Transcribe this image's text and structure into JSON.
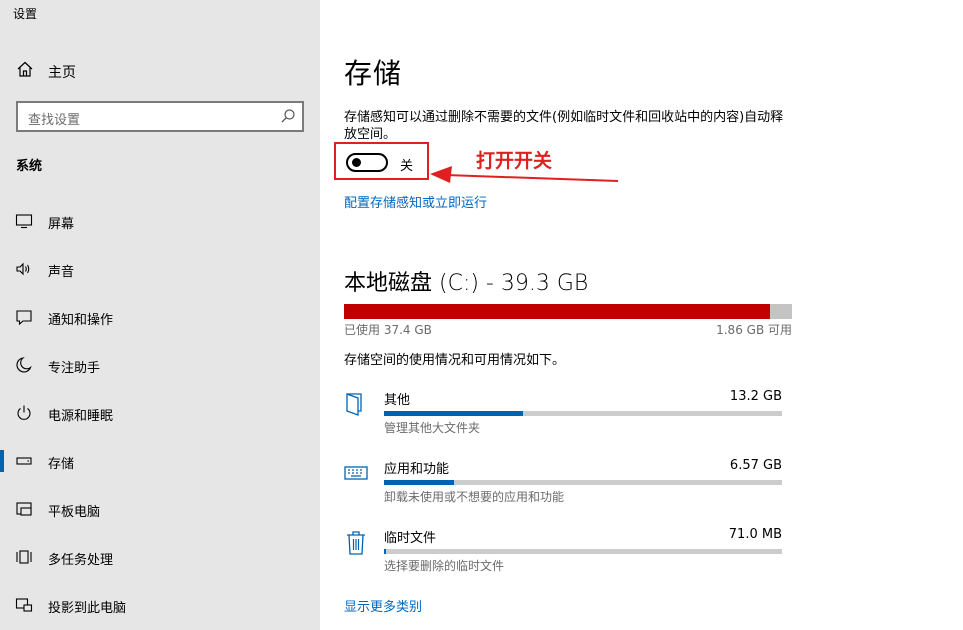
{
  "window": {
    "title": "设置"
  },
  "sidebar": {
    "home_label": "主页",
    "search_placeholder": "查找设置",
    "section_label": "系统",
    "items": [
      {
        "label": "屏幕",
        "icon": "monitor-icon"
      },
      {
        "label": "声音",
        "icon": "speaker-icon"
      },
      {
        "label": "通知和操作",
        "icon": "notification-icon"
      },
      {
        "label": "专注助手",
        "icon": "moon-icon"
      },
      {
        "label": "电源和睡眠",
        "icon": "power-icon"
      },
      {
        "label": "存储",
        "icon": "storage-icon",
        "active": true
      },
      {
        "label": "平板电脑",
        "icon": "tablet-icon"
      },
      {
        "label": "多任务处理",
        "icon": "multitask-icon"
      },
      {
        "label": "投影到此电脑",
        "icon": "project-icon"
      }
    ]
  },
  "main": {
    "title": "存储",
    "storage_sense_desc": "存储感知可以通过删除不需要的文件(例如临时文件和回收站中的内容)自动释放空间。",
    "toggle_state": "关",
    "annotation_text": "打开开关",
    "configure_link": "配置存储感知或立即运行",
    "disk_title": "本地磁盘 (C:) - 39.3 GB",
    "disk_used_fraction": 0.95,
    "used_text": "已使用 37.4 GB",
    "free_text": "1.86 GB 可用",
    "usage_desc": "存储空间的使用情况和可用情况如下。",
    "categories": [
      {
        "name": "其他",
        "size": "13.2 GB",
        "sub": "管理其他大文件夹",
        "fraction": 0.35,
        "icon": "folder-icon"
      },
      {
        "name": "应用和功能",
        "size": "6.57 GB",
        "sub": "卸载未使用或不想要的应用和功能",
        "fraction": 0.175,
        "icon": "keyboard-icon"
      },
      {
        "name": "临时文件",
        "size": "71.0 MB",
        "sub": "选择要删除的临时文件",
        "fraction": 0.004,
        "icon": "trash-icon"
      }
    ],
    "more_link": "显示更多类别"
  },
  "colors": {
    "accent": "#0063b1",
    "link": "#0067c0",
    "disk_fill": "#c00000",
    "annotation": "#e02020"
  }
}
